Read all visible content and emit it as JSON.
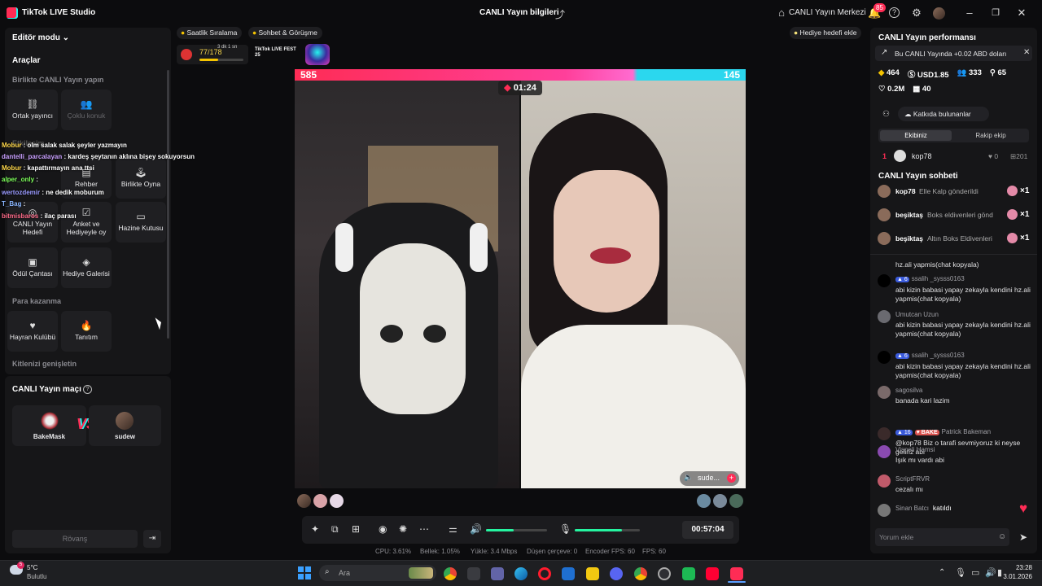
{
  "titlebar": {
    "app_name": "TikTok LIVE Studio",
    "center_title": "CANLI Yayın bilgileri",
    "center_link": "CANLI Yayın Merkezi",
    "notif_count": "85"
  },
  "left": {
    "editor_mode": "Editör modu",
    "tools_title": "Araçlar",
    "section_together": "Birlikte CANLI Yayın yapın",
    "tool_cohost": "Ortak yayıncı",
    "tool_multi_guest": "Çoklu konuk",
    "section_interaction": "Etkileşim",
    "tool_guide": "Rehber",
    "tool_play_together": "Birlikte Oyna",
    "tool_live_goal": "CANLI Yayın Hedefi",
    "tool_vote": "Anket ve Hediyeyle oy",
    "tool_treasure": "Hazine Kutusu",
    "tool_reward_bag": "Ödül Çantası",
    "tool_gift_gallery": "Hediye Galerisi",
    "section_earn": "Para kazanma",
    "tool_fan_club": "Hayran Kulübü",
    "tool_promo": "Tanıtım",
    "section_audience": "Kitlenizi genişletin",
    "match_title": "CANLI Yayın maçı",
    "match_left": "BakeMask",
    "match_right": "sudew",
    "rematch": "Rövanş"
  },
  "overlay_chat": [
    {
      "user": "Mobur",
      "text": ": olm salak salak şeyler yazmayın",
      "color": "#ffd84a"
    },
    {
      "user": "dantelli_parcalayan",
      "text": ": kardeş şeytanın aklına bişey sokuyorsun",
      "color": "#c9a0ff"
    },
    {
      "user": "Mobur",
      "text": ": kapattırmayın ana ttsi",
      "color": "#ffd84a"
    },
    {
      "user": "alper_only",
      "text": ":",
      "color": "#7dff5a"
    },
    {
      "user": "wertozdemir",
      "text": ": ne dedik moburum",
      "color": "#9a9aff"
    },
    {
      "user": "T_Bag",
      "text": ":",
      "color": "#8ab6ff"
    },
    {
      "user": "bitmisbaros",
      "text": ": ilaç parası",
      "color": "#ff6b8a"
    }
  ],
  "top_pills": {
    "hourly_rank": "Saatlik Sıralama",
    "chat_meet": "Sohbet & Görüşme",
    "gift_goal": "Hediye hedefi ekle",
    "goal_progress": "77/178",
    "countdown": "3 dk 1 sn",
    "fest_label": "TikTok LIVE FEST 25"
  },
  "battle": {
    "left_score": "585",
    "right_score": "145",
    "timer": "01:24",
    "right_name": "sude...",
    "left_share": 0.8
  },
  "controls": {
    "elapsed": "00:57:04",
    "volume_level": 0.45,
    "mic_level": 0.72
  },
  "stats": {
    "cpu": "CPU:  3.61%",
    "memory": "Bellek:  1.05%",
    "upload": "Yükle:  3.4 Mbps",
    "dropped": "Düşen çerçeve:  0",
    "encoder_fps": "Encoder FPS:  60",
    "fps": "FPS:  60"
  },
  "right": {
    "perf_title": "CANLI Yayın performansı",
    "perf_banner": "Bu CANLI Yayında +0.02 ABD doları",
    "stat_diamonds": "464",
    "stat_usd": "USD1.85",
    "stat_viewers": "333",
    "stat_new": "65",
    "stat_likes": "0.2M",
    "stat_gifters": "40",
    "contributors_btn": "Katkıda bulunanlar",
    "tab_ours": "Ekibiniz",
    "tab_rival": "Rakip ekip",
    "contrib_rank": "1",
    "contrib_user": "kop78",
    "contrib_likes": "0",
    "contrib_gifts": "201",
    "chat_title": "CANLI Yayın sohbeti",
    "gift_rows": [
      {
        "user": "kop78",
        "text": "Elle Kalp gönderildi",
        "count": "×1"
      },
      {
        "user": "beşiktaş",
        "text": "Boks eldivenleri gönd",
        "count": "×1"
      },
      {
        "user": "beşiktaş",
        "text": "Altın Boks Eldivenleri",
        "count": "×1"
      }
    ],
    "chat": [
      {
        "user": "",
        "text": "hz.ali yapmis(chat kopyala)"
      },
      {
        "user": "ssalih _sysss0163",
        "level": "6",
        "text": "abi kizin babasi yapay zekayla kendini hz.ali yapmis(chat kopyala)"
      },
      {
        "user": "Umutcan Uzun",
        "text": "abi kizin babasi yapay zekayla kendini hz.ali yapmis(chat kopyala)"
      },
      {
        "user": "ssalih _sysss0163",
        "level": "6",
        "text": "abi kizin babasi yapay zekayla kendini hz.ali yapmis(chat kopyala)"
      },
      {
        "user": "sagosilva",
        "text": "banada kari lazim"
      },
      {
        "user": "Patrick Bakeman",
        "level": "16",
        "tag": "BAKE",
        "text": "@kop78 Biz o tarafi sevmiyoruz ki neyse geliriz abi"
      },
      {
        "user": "Vişneli Hamsi",
        "text": "Işık mı vardı abi"
      },
      {
        "user": "ScriptFRVR",
        "text": "cezalı mı"
      },
      {
        "user": "Sinan Batcı",
        "text": "katıldı"
      }
    ],
    "comment_placeholder": "Yorum ekle"
  },
  "taskbar": {
    "temp": "5°C",
    "weather": "Bulutlu",
    "search": "Ara",
    "time": "23:28",
    "date": "3.01.2026",
    "weather_badge": "5"
  }
}
